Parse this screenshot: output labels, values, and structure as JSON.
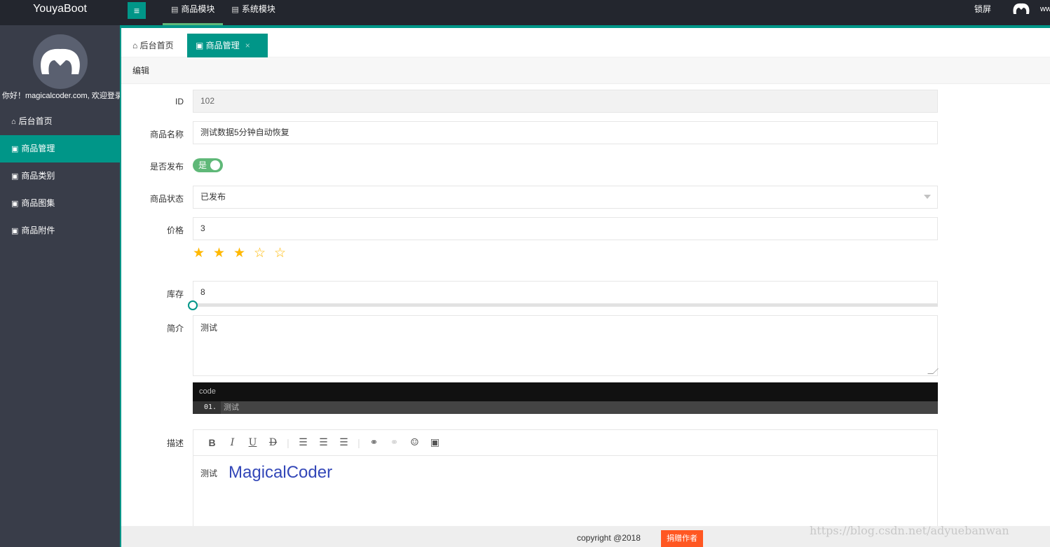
{
  "header": {
    "logo": "YouyaBoot",
    "menu_icon": "≡",
    "nav": [
      {
        "label": "商品模块",
        "icon": "doc-icon"
      },
      {
        "label": "系统模块",
        "icon": "doc-icon"
      }
    ],
    "lock_label": "锁屏",
    "site_text": "www"
  },
  "sidebar": {
    "welcome": "你好！magicalcoder.com, 欢迎登录",
    "items": [
      {
        "label": "后台首页",
        "icon": "home-icon"
      },
      {
        "label": "商品管理",
        "icon": "image-icon"
      },
      {
        "label": "商品类别",
        "icon": "image-icon"
      },
      {
        "label": "商品图集",
        "icon": "image-icon"
      },
      {
        "label": "商品附件",
        "icon": "image-icon"
      }
    ]
  },
  "tabs": {
    "home": "后台首页",
    "current": "商品管理",
    "close": "×"
  },
  "breadcrumb": "编辑",
  "form": {
    "id_label": "ID",
    "id_value": "102",
    "name_label": "商品名称",
    "name_value": "测试数据5分钟自动恢复",
    "publish_label": "是否发布",
    "publish_value": "是",
    "status_label": "商品状态",
    "status_value": "已发布",
    "price_label": "价格",
    "price_value": "3",
    "rating": 3,
    "rating_max": 5,
    "stock_label": "库存",
    "stock_value": "8",
    "slider_fraction": 0,
    "intro_label": "简介",
    "intro_value": "测试",
    "code_header": "code",
    "code_line_num": "01.",
    "code_line_text": "测试",
    "desc_label": "描述",
    "desc_plain": "测试",
    "desc_big": "MagicalCoder"
  },
  "footer": {
    "copyright": "copyright @2018",
    "donate": "捐赠作者"
  },
  "watermark": "https://blog.csdn.net/adyuebanwan",
  "colors": {
    "accent": "#009688",
    "header_bg": "#23262e",
    "sidebar_bg": "#393d49",
    "star": "#ffb800",
    "switch_on": "#5fb878",
    "donate": "#ff5722"
  }
}
